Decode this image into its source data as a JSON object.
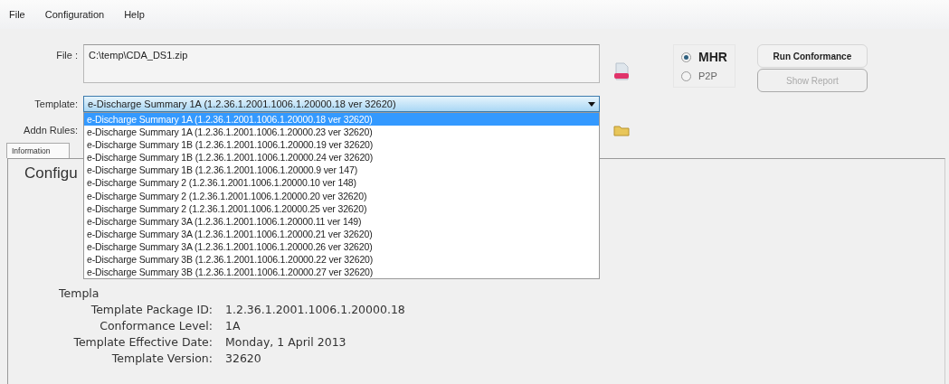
{
  "menu": [
    {
      "label": "File"
    },
    {
      "label": "Configuration"
    },
    {
      "label": "Help"
    }
  ],
  "file": {
    "label": "File :",
    "value": "C:\\temp\\CDA_DS1.zip"
  },
  "mode_options": [
    {
      "label": "MHR",
      "selected": true
    },
    {
      "label": "P2P",
      "selected": false
    }
  ],
  "buttons": [
    {
      "label": "Run Conformance",
      "disabled": false
    },
    {
      "label": "Show Report",
      "disabled": true
    }
  ],
  "template": {
    "label": "Template:",
    "value": "e-Discharge Summary 1A  (1.2.36.1.2001.1006.1.20000.18 ver 32620)",
    "expanded": true,
    "options": [
      {
        "label": "e-Discharge Summary 1A  (1.2.36.1.2001.1006.1.20000.18 ver 32620)",
        "selected": true
      },
      {
        "label": "e-Discharge Summary 1A  (1.2.36.1.2001.1006.1.20000.23 ver 32620)",
        "selected": false
      },
      {
        "label": "e-Discharge Summary 1B  (1.2.36.1.2001.1006.1.20000.19 ver 32620)",
        "selected": false
      },
      {
        "label": "e-Discharge Summary 1B  (1.2.36.1.2001.1006.1.20000.24 ver 32620)",
        "selected": false
      },
      {
        "label": "e-Discharge Summary 1B  (1.2.36.1.2001.1006.1.20000.9 ver 147)",
        "selected": false
      },
      {
        "label": "e-Discharge Summary 2  (1.2.36.1.2001.1006.1.20000.10 ver 148)",
        "selected": false
      },
      {
        "label": "e-Discharge Summary 2  (1.2.36.1.2001.1006.1.20000.20 ver 32620)",
        "selected": false
      },
      {
        "label": "e-Discharge Summary 2  (1.2.36.1.2001.1006.1.20000.25 ver 32620)",
        "selected": false
      },
      {
        "label": "e-Discharge Summary 3A  (1.2.36.1.2001.1006.1.20000.11 ver 149)",
        "selected": false
      },
      {
        "label": "e-Discharge Summary 3A  (1.2.36.1.2001.1006.1.20000.21 ver 32620)",
        "selected": false
      },
      {
        "label": "e-Discharge Summary 3A  (1.2.36.1.2001.1006.1.20000.26 ver 32620)",
        "selected": false
      },
      {
        "label": "e-Discharge Summary 3B  (1.2.36.1.2001.1006.1.20000.22 ver 32620)",
        "selected": false
      },
      {
        "label": "e-Discharge Summary 3B  (1.2.36.1.2001.1006.1.20000.27 ver 32620)",
        "selected": false
      }
    ]
  },
  "addn_rules": {
    "label": "Addn Rules:"
  },
  "tabs": [
    {
      "label": "Information",
      "selected": true
    }
  ],
  "panel": {
    "title": "Configu",
    "partial_label": "Templa",
    "fields": [
      {
        "label": "Template Package ID:",
        "value": "1.2.36.1.2001.1006.1.20000.18"
      },
      {
        "label": "Conformance Level:",
        "value": "1A"
      },
      {
        "label": "Template Effective Date:",
        "value": "Monday, 1 April 2013"
      },
      {
        "label": "Template Version:",
        "value": "32620"
      }
    ]
  }
}
